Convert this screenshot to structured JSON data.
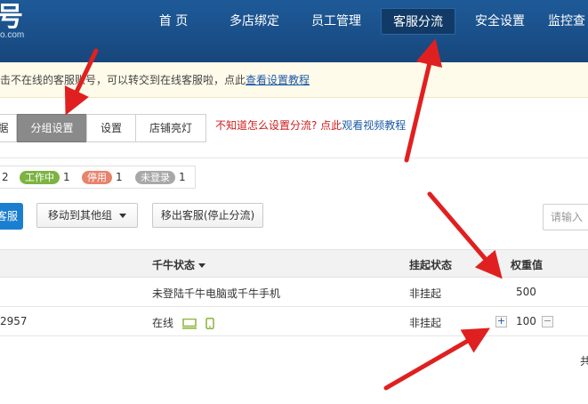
{
  "header": {
    "logo_char": "号",
    "logo_sub": "o.com",
    "nav": [
      {
        "label": "首 页",
        "active": false
      },
      {
        "label": "多店绑定",
        "active": false
      },
      {
        "label": "员工管理",
        "active": false
      },
      {
        "label": "客服分流",
        "active": true
      },
      {
        "label": "安全设置",
        "active": false
      },
      {
        "label": "监控查",
        "active": false
      }
    ]
  },
  "notice": {
    "text": "击不在线的客服账号，可以转交到在线客服啦，点此",
    "link": "查看设置教程"
  },
  "tabs": {
    "items": [
      {
        "label": "据",
        "active": false
      },
      {
        "label": "分组设置",
        "active": true
      },
      {
        "label": "设置",
        "active": false
      },
      {
        "label": "店铺亮灯",
        "active": false
      }
    ],
    "hint_text": "不知道怎么设置分流? 点此",
    "hint_link": "观看视频教程"
  },
  "legend": {
    "first_count": "2",
    "items": [
      {
        "label": "工作中",
        "count": "1",
        "color": "#7cb342"
      },
      {
        "label": "停用",
        "count": "1",
        "color": "#e8826c"
      },
      {
        "label": "未登录",
        "count": "1",
        "color": "#a8a8a8"
      }
    ]
  },
  "toolbar": {
    "primary_label": "客服",
    "move_label": "移动到其他组",
    "remove_label": "移出客服(停止分流)",
    "search_placeholder": "请输入"
  },
  "table": {
    "headers": {
      "qianniu_status": "千牛状态",
      "hang_status": "挂起状态",
      "weight": "权重值"
    },
    "rows": [
      {
        "id": "",
        "qianniu_status": "未登陆千牛电脑或千牛手机",
        "hang_status": "非挂起",
        "weight": "500",
        "has_stepper": false
      },
      {
        "id": "2957",
        "qianniu_status": "在线",
        "hang_status": "非挂起",
        "weight": "100",
        "has_stepper": true
      }
    ]
  },
  "footer_char": "共",
  "colors": {
    "header_bg": "#1a4f88",
    "annotation_arrow": "#e02020",
    "link": "#1d5aa5"
  }
}
